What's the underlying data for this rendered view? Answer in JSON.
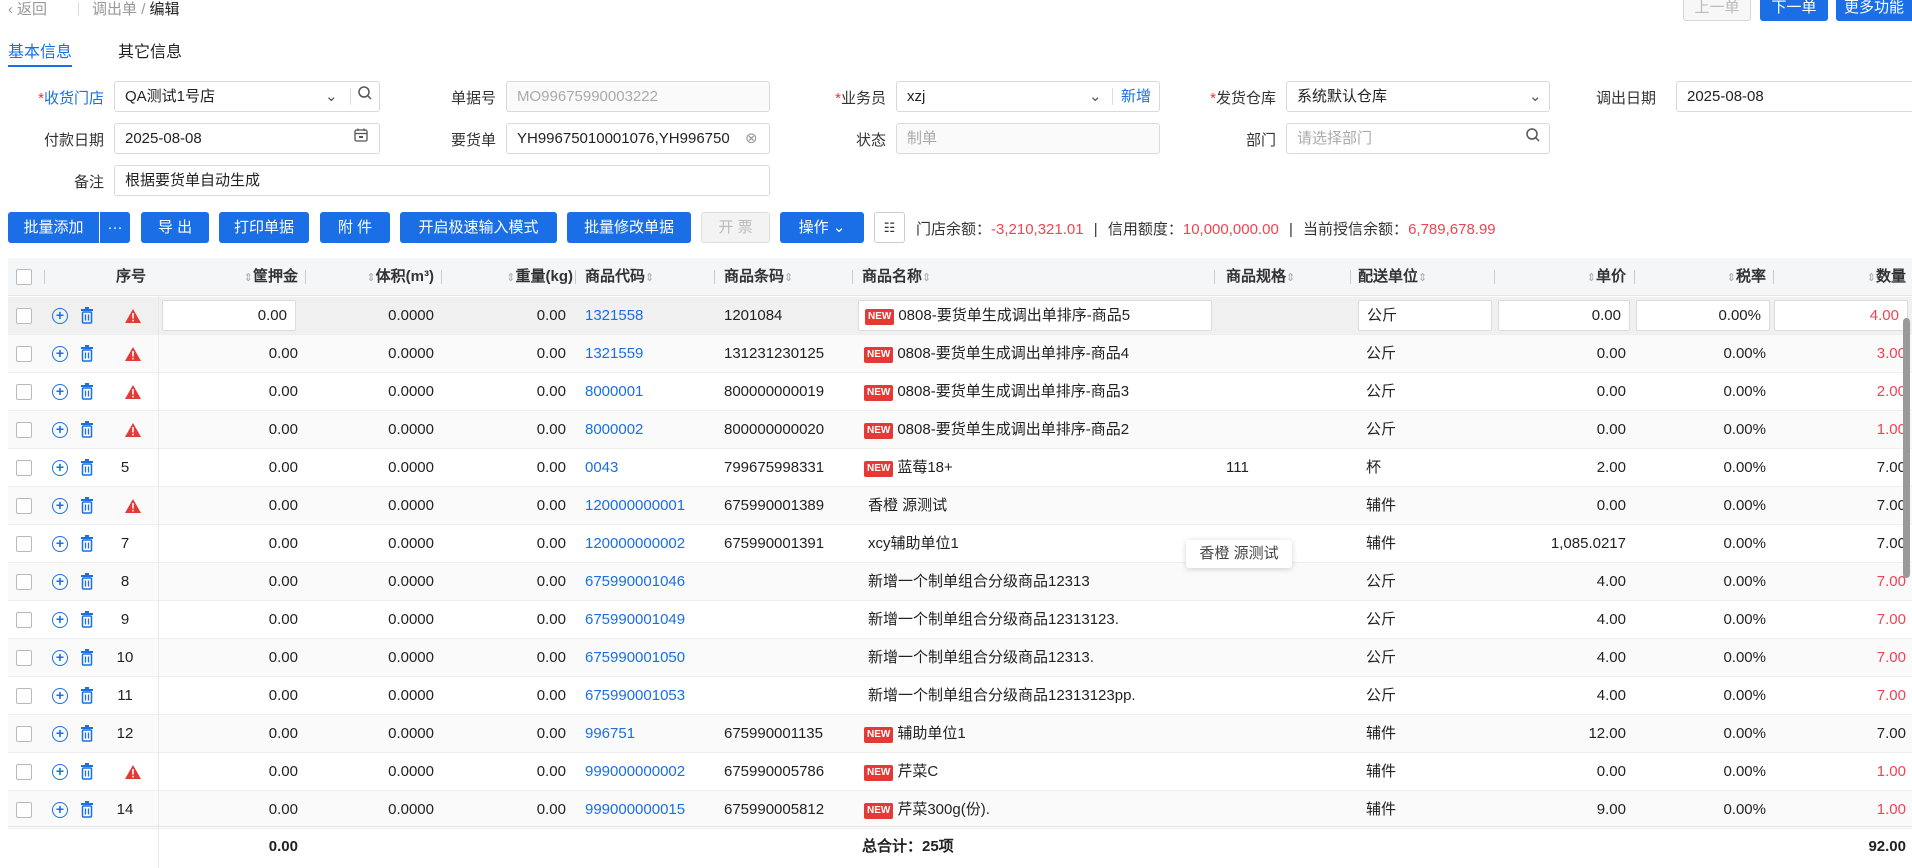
{
  "topbar": {
    "back_label": "返回",
    "breadcrumb_parent": "调出单",
    "breadcrumb_sep": "/",
    "breadcrumb_current": "编辑",
    "prev_label": "上一单",
    "next_label": "下一单",
    "more_label": "更多功能"
  },
  "tabs": [
    "基本信息",
    "其它信息"
  ],
  "form": {
    "store_label": "收货门店",
    "store_value": "QA测试1号店",
    "docno_label": "单据号",
    "docno_value": "MO99675990003222",
    "salesman_label": "业务员",
    "salesman_value": "xzj",
    "salesman_add": "新增",
    "warehouse_label": "发货仓库",
    "warehouse_value": "系统默认仓库",
    "outdate_label": "调出日期",
    "outdate_value": "2025-08-08",
    "paydate_label": "付款日期",
    "paydate_value": "2025-08-08",
    "reqno_label": "要货单",
    "reqno_value": "YH99675010001076,YH996750",
    "status_label": "状态",
    "status_value": "制单",
    "dept_label": "部门",
    "dept_placeholder": "请选择部门",
    "remark_label": "备注",
    "remark_value": "根据要货单自动生成"
  },
  "toolbar": {
    "batch_add": "批量添加",
    "more_dots": "···",
    "export": "导 出",
    "print": "打印单据",
    "attach": "附 件",
    "fast_input": "开启极速输入模式",
    "batch_edit": "批量修改单据",
    "invoice": "开 票",
    "operate": "操作",
    "store_balance_label": "门店余额：",
    "store_balance": "-3,210,321.01",
    "credit_label": "信用额度：",
    "credit": "10,000,000.00",
    "credit_left_label": "当前授信余额：",
    "credit_left": "6,789,678.99",
    "sep": "|"
  },
  "table": {
    "headers": {
      "seq": "序号",
      "deposit": "筐押金",
      "volume": "体积(m³)",
      "weight": "重量(kg)",
      "code": "商品代码",
      "barcode": "商品条码",
      "name": "商品名称",
      "spec": "商品规格",
      "unit": "配送单位",
      "price": "单价",
      "tax": "税率",
      "qty": "数量"
    },
    "new_tag": "NEW",
    "rows": [
      {
        "seq": "",
        "warn": true,
        "deposit": "0.00",
        "volume": "0.0000",
        "weight": "0.00",
        "code": "1321558",
        "barcode": "1201084",
        "new": true,
        "name": "0808-要货单生成调出单排序-商品5",
        "spec": "",
        "unit": "公斤",
        "price": "0.00",
        "tax": "0.00%",
        "qty": "4.00",
        "qty_red": true
      },
      {
        "seq": "",
        "warn": true,
        "deposit": "0.00",
        "volume": "0.0000",
        "weight": "0.00",
        "code": "1321559",
        "barcode": "131231230125",
        "new": true,
        "name": "0808-要货单生成调出单排序-商品4",
        "spec": "",
        "unit": "公斤",
        "price": "0.00",
        "tax": "0.00%",
        "qty": "3.00",
        "qty_red": true
      },
      {
        "seq": "",
        "warn": true,
        "deposit": "0.00",
        "volume": "0.0000",
        "weight": "0.00",
        "code": "8000001",
        "barcode": "800000000019",
        "new": true,
        "name": "0808-要货单生成调出单排序-商品3",
        "spec": "",
        "unit": "公斤",
        "price": "0.00",
        "tax": "0.00%",
        "qty": "2.00",
        "qty_red": true
      },
      {
        "seq": "",
        "warn": true,
        "deposit": "0.00",
        "volume": "0.0000",
        "weight": "0.00",
        "code": "8000002",
        "barcode": "800000000020",
        "new": true,
        "name": "0808-要货单生成调出单排序-商品2",
        "spec": "",
        "unit": "公斤",
        "price": "0.00",
        "tax": "0.00%",
        "qty": "1.00",
        "qty_red": true
      },
      {
        "seq": "5",
        "warn": false,
        "deposit": "0.00",
        "volume": "0.0000",
        "weight": "0.00",
        "code": "0043",
        "barcode": "799675998331",
        "new": true,
        "name": "蓝莓18+",
        "spec": "111",
        "unit": "杯",
        "price": "2.00",
        "tax": "0.00%",
        "qty": "7.00",
        "qty_red": false
      },
      {
        "seq": "",
        "warn": true,
        "deposit": "0.00",
        "volume": "0.0000",
        "weight": "0.00",
        "code": "120000000001",
        "barcode": "675990001389",
        "new": false,
        "name": "香橙 源测试",
        "spec": "",
        "unit": "辅件",
        "price": "0.00",
        "tax": "0.00%",
        "qty": "7.00",
        "qty_red": false
      },
      {
        "seq": "7",
        "warn": false,
        "deposit": "0.00",
        "volume": "0.0000",
        "weight": "0.00",
        "code": "120000000002",
        "barcode": "675990001391",
        "new": false,
        "name": "xcy辅助单位1",
        "spec": "",
        "unit": "辅件",
        "price": "1,085.0217",
        "tax": "0.00%",
        "qty": "7.00",
        "qty_red": false
      },
      {
        "seq": "8",
        "warn": false,
        "deposit": "0.00",
        "volume": "0.0000",
        "weight": "0.00",
        "code": "675990001046",
        "barcode": "",
        "new": false,
        "name": "新增一个制单组合分级商品12313",
        "spec": "",
        "unit": "公斤",
        "price": "4.00",
        "tax": "0.00%",
        "qty": "7.00",
        "qty_red": true
      },
      {
        "seq": "9",
        "warn": false,
        "deposit": "0.00",
        "volume": "0.0000",
        "weight": "0.00",
        "code": "675990001049",
        "barcode": "",
        "new": false,
        "name": "新增一个制单组合分级商品12313123.",
        "spec": "",
        "unit": "公斤",
        "price": "4.00",
        "tax": "0.00%",
        "qty": "7.00",
        "qty_red": true
      },
      {
        "seq": "10",
        "warn": false,
        "deposit": "0.00",
        "volume": "0.0000",
        "weight": "0.00",
        "code": "675990001050",
        "barcode": "",
        "new": false,
        "name": "新增一个制单组合分级商品12313.",
        "spec": "",
        "unit": "公斤",
        "price": "4.00",
        "tax": "0.00%",
        "qty": "7.00",
        "qty_red": true
      },
      {
        "seq": "11",
        "warn": false,
        "deposit": "0.00",
        "volume": "0.0000",
        "weight": "0.00",
        "code": "675990001053",
        "barcode": "",
        "new": false,
        "name": "新增一个制单组合分级商品12313123pp.",
        "spec": "",
        "unit": "公斤",
        "price": "4.00",
        "tax": "0.00%",
        "qty": "7.00",
        "qty_red": true
      },
      {
        "seq": "12",
        "warn": false,
        "deposit": "0.00",
        "volume": "0.0000",
        "weight": "0.00",
        "code": "996751",
        "barcode": "675990001135",
        "new": true,
        "name": "辅助单位1",
        "spec": "",
        "unit": "辅件",
        "price": "12.00",
        "tax": "0.00%",
        "qty": "7.00",
        "qty_red": false
      },
      {
        "seq": "",
        "warn": true,
        "deposit": "0.00",
        "volume": "0.0000",
        "weight": "0.00",
        "code": "999000000002",
        "barcode": "675990005786",
        "new": true,
        "name": "芹菜C",
        "spec": "",
        "unit": "辅件",
        "price": "0.00",
        "tax": "0.00%",
        "qty": "1.00",
        "qty_red": true
      },
      {
        "seq": "14",
        "warn": false,
        "deposit": "0.00",
        "volume": "0.0000",
        "weight": "0.00",
        "code": "999000000015",
        "barcode": "675990005812",
        "new": true,
        "name": "芹菜300g(份).",
        "spec": "",
        "unit": "辅件",
        "price": "9.00",
        "tax": "0.00%",
        "qty": "1.00",
        "qty_red": true
      }
    ],
    "footer": {
      "deposit_total": "0.00",
      "name_total": "总合计：25项",
      "qty_total": "92.00"
    },
    "tooltip": "香橙 源测试"
  },
  "colors": {
    "primary": "#1a6fe6",
    "danger": "#e45",
    "new_tag": "#e53935"
  }
}
